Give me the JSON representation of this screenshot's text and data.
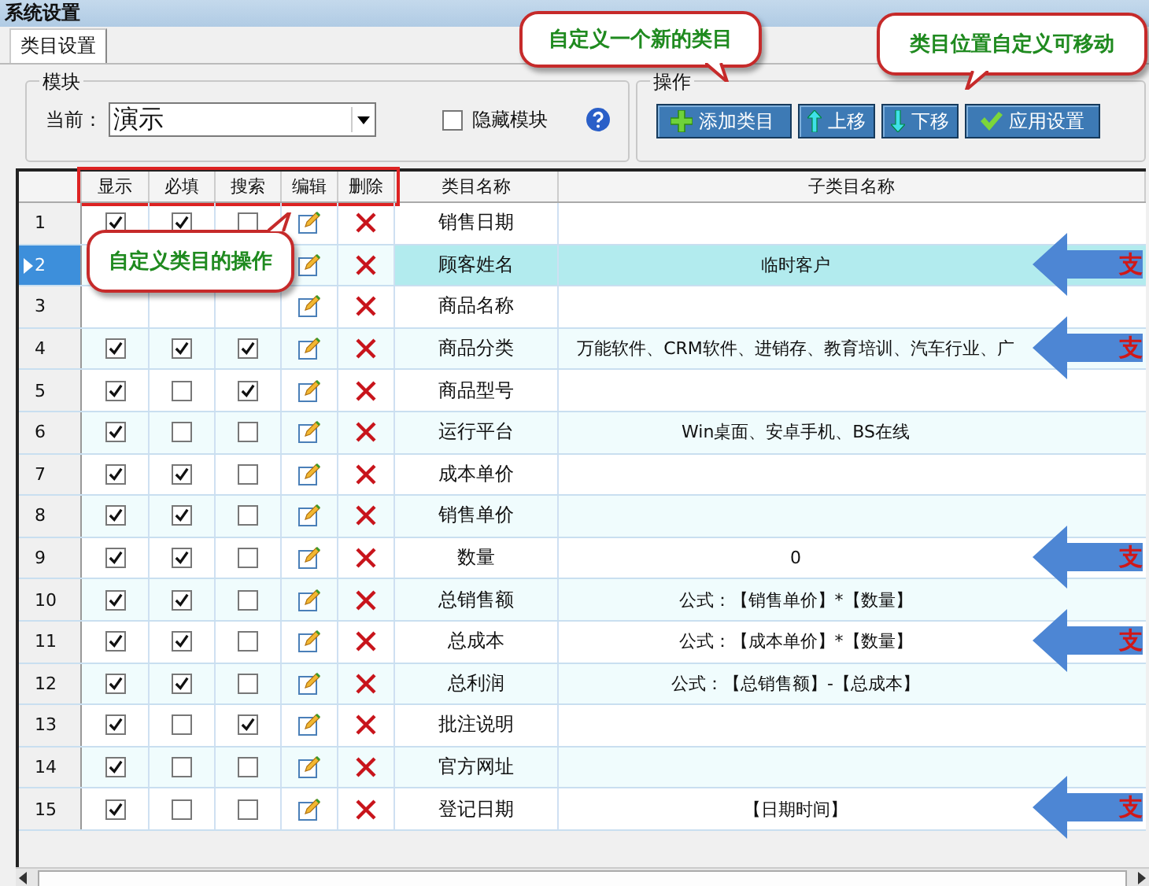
{
  "window": {
    "title": "系统设置"
  },
  "tabs": [
    {
      "label": "类目设置",
      "selected": true
    }
  ],
  "module_group": {
    "title": "模块",
    "current_label": "当前：",
    "current_value": "演示",
    "hide_checkbox": {
      "label": "隐藏模块",
      "checked": false
    }
  },
  "actions_group": {
    "title": "操作",
    "buttons": [
      {
        "label": "添加类目",
        "kind": "add"
      },
      {
        "label": "上移",
        "kind": "up"
      },
      {
        "label": "下移",
        "kind": "down"
      },
      {
        "label": "应用设置",
        "kind": "apply"
      }
    ]
  },
  "table": {
    "columns": [
      "显示",
      "必填",
      "搜索",
      "编辑",
      "删除",
      "类目名称",
      "子类目名称"
    ],
    "rows": [
      {
        "index": "1",
        "selected": false,
        "show": true,
        "required": true,
        "search": false,
        "name": "销售日期"
      },
      {
        "index": "2",
        "selected": true,
        "name": "顾客姓名",
        "sub": "临时客户",
        "arrow_label": "支"
      },
      {
        "index": "3",
        "selected": false,
        "name": "商品名称"
      },
      {
        "index": "4",
        "selected": false,
        "show": true,
        "required": true,
        "search": true,
        "name": "商品分类",
        "sub": "万能软件、CRM软件、进销存、教育培训、汽车行业、广",
        "arrow_label": "支"
      },
      {
        "index": "5",
        "selected": false,
        "show": true,
        "required": false,
        "search": true,
        "name": "商品型号"
      },
      {
        "index": "6",
        "selected": false,
        "show": true,
        "required": false,
        "search": false,
        "name": "运行平台",
        "sub": "Win桌面、安卓手机、BS在线"
      },
      {
        "index": "7",
        "selected": false,
        "show": true,
        "required": true,
        "search": false,
        "name": "成本单价"
      },
      {
        "index": "8",
        "selected": false,
        "show": true,
        "required": true,
        "search": false,
        "name": "销售单价"
      },
      {
        "index": "9",
        "selected": false,
        "show": true,
        "required": true,
        "search": false,
        "name": "数量",
        "sub": "0",
        "arrow_label": "支"
      },
      {
        "index": "10",
        "selected": false,
        "show": true,
        "required": true,
        "search": false,
        "name": "总销售额",
        "sub": "公式：【销售单价】*【数量】"
      },
      {
        "index": "11",
        "selected": false,
        "show": true,
        "required": true,
        "search": false,
        "name": "总成本",
        "sub": "公式：【成本单价】*【数量】",
        "arrow_label": "支"
      },
      {
        "index": "12",
        "selected": false,
        "show": true,
        "required": true,
        "search": false,
        "name": "总利润",
        "sub": "公式：【总销售额】-【总成本】"
      },
      {
        "index": "13",
        "selected": false,
        "show": true,
        "required": false,
        "search": true,
        "name": "批注说明"
      },
      {
        "index": "14",
        "selected": false,
        "show": true,
        "required": false,
        "search": false,
        "name": "官方网址"
      },
      {
        "index": "15",
        "selected": false,
        "show": true,
        "required": false,
        "search": false,
        "name": "登记日期",
        "sub": "【日期时间】",
        "arrow_label": "支"
      }
    ]
  },
  "callouts": [
    {
      "text": "自定义一个新的类目"
    },
    {
      "text": "类目位置自定义可移动"
    },
    {
      "text": "自定义类目的操作"
    }
  ]
}
